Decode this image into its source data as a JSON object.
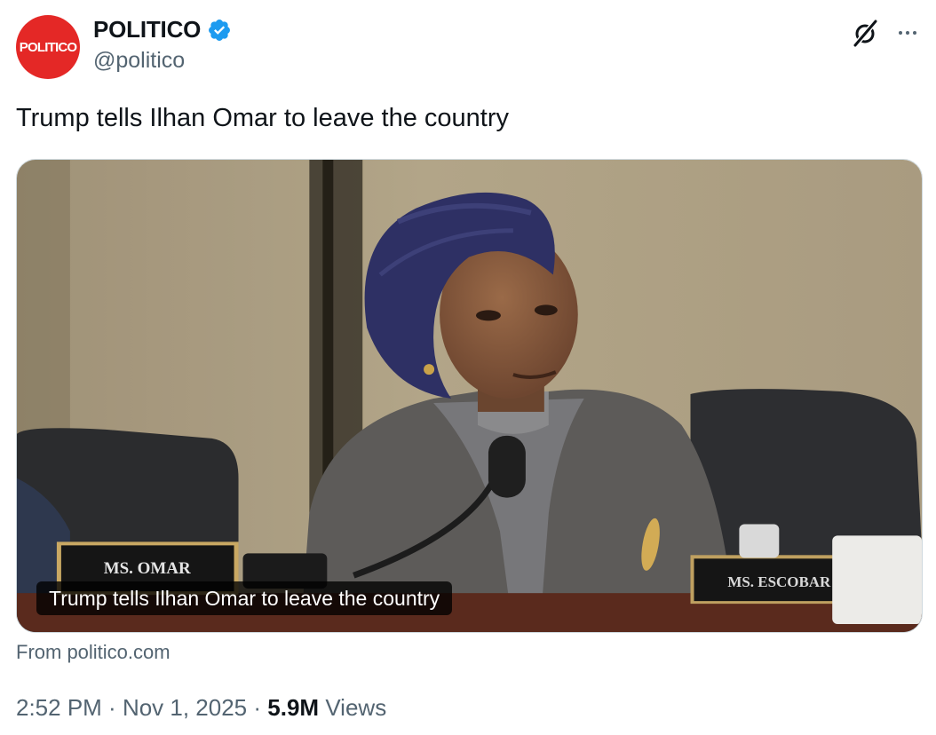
{
  "author": {
    "avatar_text": "POLITICO",
    "display_name": "POLITICO",
    "handle": "@politico",
    "verified_icon": "verified-badge-icon",
    "verified_color": "#1d9bf0",
    "avatar_color": "#e42826"
  },
  "header_actions": {
    "grok_icon": "grok-icon",
    "more_icon": "more-horizontal-icon"
  },
  "tweet": {
    "text": "Trump tells Ilhan Omar to leave the country"
  },
  "media": {
    "caption": "Trump tells Ilhan Omar to leave the country",
    "nameplate_left": "MS. OMAR",
    "nameplate_right": "MS. ESCOBAR",
    "source": "From politico.com"
  },
  "meta": {
    "time": "2:52 PM",
    "separator": " · ",
    "date": "Nov 1, 2025",
    "views_count": "5.9M",
    "views_label": "Views"
  }
}
